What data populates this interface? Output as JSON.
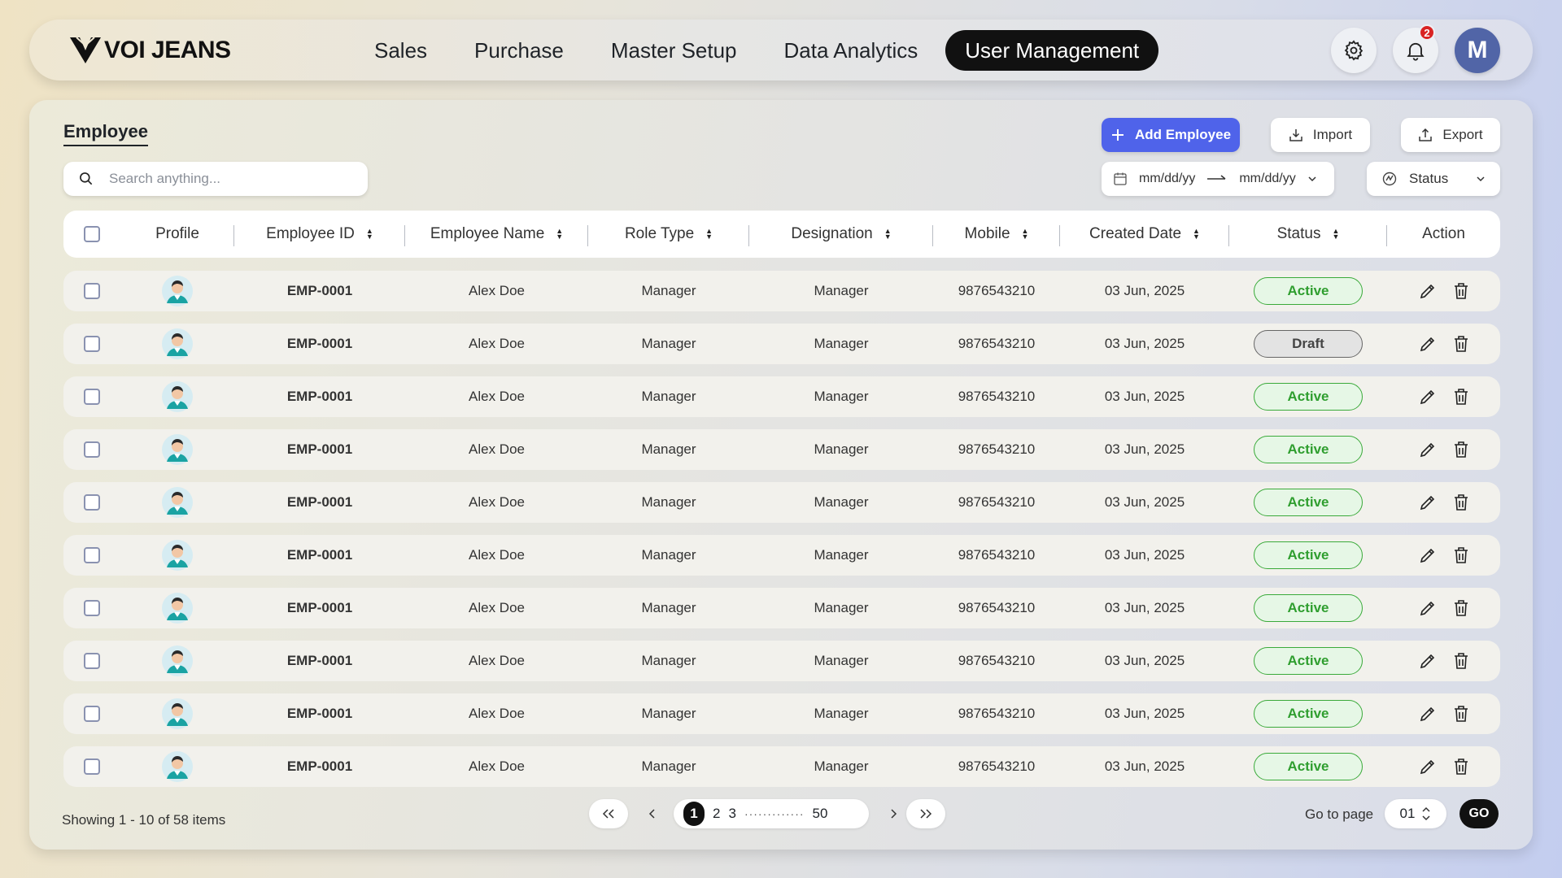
{
  "brand": {
    "name": "VOI JEANS"
  },
  "nav": {
    "items": [
      {
        "label": "Sales"
      },
      {
        "label": "Purchase"
      },
      {
        "label": "Master Setup"
      },
      {
        "label": "Data Analytics"
      },
      {
        "label": "User Management",
        "active": true
      }
    ]
  },
  "header": {
    "notification_count": "2",
    "avatar_initial": "M",
    "settings_icon": "gear-icon",
    "notification_icon": "bell-icon"
  },
  "page": {
    "title": "Employee"
  },
  "search": {
    "placeholder": "Search anything..."
  },
  "actions": {
    "add_label": "Add Employee",
    "import_label": "Import",
    "export_label": "Export"
  },
  "filters": {
    "date_from_placeholder": "mm/dd/yy",
    "date_to_placeholder": "mm/dd/yy",
    "status_label": "Status"
  },
  "table": {
    "columns": [
      "Profile",
      "Employee ID",
      "Employee Name",
      "Role Type",
      "Designation",
      "Mobile",
      "Created Date",
      "Status",
      "Action"
    ],
    "rows": [
      {
        "id": "EMP-0001",
        "name": "Alex Doe",
        "role": "Manager",
        "designation": "Manager",
        "mobile": "9876543210",
        "created": "03 Jun, 2025",
        "status": "Active"
      },
      {
        "id": "EMP-0001",
        "name": "Alex Doe",
        "role": "Manager",
        "designation": "Manager",
        "mobile": "9876543210",
        "created": "03 Jun, 2025",
        "status": "Draft"
      },
      {
        "id": "EMP-0001",
        "name": "Alex Doe",
        "role": "Manager",
        "designation": "Manager",
        "mobile": "9876543210",
        "created": "03 Jun, 2025",
        "status": "Active"
      },
      {
        "id": "EMP-0001",
        "name": "Alex Doe",
        "role": "Manager",
        "designation": "Manager",
        "mobile": "9876543210",
        "created": "03 Jun, 2025",
        "status": "Active"
      },
      {
        "id": "EMP-0001",
        "name": "Alex Doe",
        "role": "Manager",
        "designation": "Manager",
        "mobile": "9876543210",
        "created": "03 Jun, 2025",
        "status": "Active"
      },
      {
        "id": "EMP-0001",
        "name": "Alex Doe",
        "role": "Manager",
        "designation": "Manager",
        "mobile": "9876543210",
        "created": "03 Jun, 2025",
        "status": "Active"
      },
      {
        "id": "EMP-0001",
        "name": "Alex Doe",
        "role": "Manager",
        "designation": "Manager",
        "mobile": "9876543210",
        "created": "03 Jun, 2025",
        "status": "Active"
      },
      {
        "id": "EMP-0001",
        "name": "Alex Doe",
        "role": "Manager",
        "designation": "Manager",
        "mobile": "9876543210",
        "created": "03 Jun, 2025",
        "status": "Active"
      },
      {
        "id": "EMP-0001",
        "name": "Alex Doe",
        "role": "Manager",
        "designation": "Manager",
        "mobile": "9876543210",
        "created": "03 Jun, 2025",
        "status": "Active"
      },
      {
        "id": "EMP-0001",
        "name": "Alex Doe",
        "role": "Manager",
        "designation": "Manager",
        "mobile": "9876543210",
        "created": "03 Jun, 2025",
        "status": "Active"
      }
    ]
  },
  "pagination": {
    "info": "Showing 1 - 10 of 58 items",
    "pages": [
      "1",
      "2",
      "3"
    ],
    "dots": "·············",
    "last_page": "50",
    "go_to_label": "Go to page",
    "go_to_value": "01",
    "go_label": "GO"
  },
  "colors": {
    "accent": "#4f63ea",
    "active_green": "#2f9e2f",
    "nav_active_bg": "#111111",
    "avatar_bg": "#5165a7",
    "badge_red": "#d92323"
  }
}
